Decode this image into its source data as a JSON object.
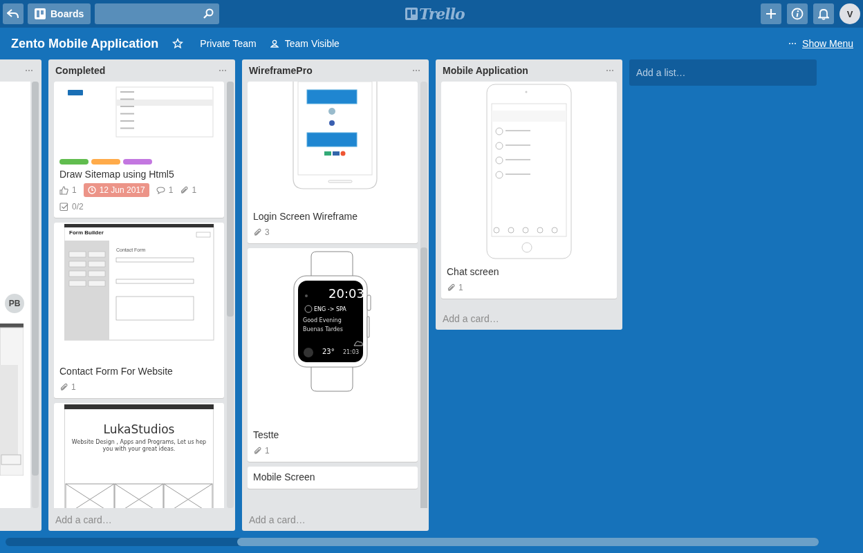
{
  "header": {
    "boards_label": "Boards",
    "logo_text": "Trello",
    "avatar": "V"
  },
  "board": {
    "title": "Zento Mobile Application",
    "starred": false,
    "team": "Private Team",
    "visibility": "Team Visible",
    "show_menu": "Show Menu"
  },
  "partial_list": {
    "member_avatar": "PB"
  },
  "lists": [
    {
      "title": "Completed",
      "add_card": "Add a card…",
      "cards": [
        {
          "cover": {
            "kind": "sitemap"
          },
          "labels": [
            {
              "color": "#61bd4f"
            },
            {
              "color": "#ffab4a"
            },
            {
              "color": "#c377e0"
            }
          ],
          "title": "Draw Sitemap using Html5",
          "badges": [
            {
              "kind": "votes",
              "text": "1"
            },
            {
              "kind": "due",
              "text": "12 Jun 2017",
              "overdue": true
            },
            {
              "kind": "comments",
              "text": "1"
            },
            {
              "kind": "attachments",
              "text": "1"
            },
            {
              "kind": "checklist",
              "text": "0/2"
            }
          ]
        },
        {
          "cover": {
            "kind": "form",
            "heading": "Form Builder",
            "form_title": "Contact Form"
          },
          "title": "Contact Form For Website",
          "badges": [
            {
              "kind": "attachments",
              "text": "1"
            }
          ]
        },
        {
          "cover": {
            "kind": "website",
            "brand": "LukaStudios",
            "tagline": "Website Design , Apps and Programs, Let us hep you with your great ideas."
          }
        }
      ]
    },
    {
      "title": "WireframePro",
      "add_card": "Add a card…",
      "cards": [
        {
          "cover": {
            "kind": "phone-login"
          },
          "title": "Login Screen Wireframe",
          "badges": [
            {
              "kind": "attachments",
              "text": "3"
            }
          ]
        },
        {
          "cover": {
            "kind": "watch",
            "time": "20:03",
            "language": "ENG -> SPA",
            "greeting": "Good Evening",
            "greeting_translated": "Buenas Tardes",
            "temperature": "23°",
            "time_small": "21:03"
          },
          "title": "Testte",
          "badges": [
            {
              "kind": "attachments",
              "text": "1"
            }
          ]
        },
        {
          "title": "Mobile Screen"
        }
      ]
    },
    {
      "title": "Mobile Application",
      "add_card": "Add a card…",
      "cards": [
        {
          "cover": {
            "kind": "phone-chat"
          },
          "title": "Chat screen",
          "badges": [
            {
              "kind": "attachments",
              "text": "1"
            }
          ]
        }
      ]
    }
  ],
  "add_list": "Add a list…"
}
